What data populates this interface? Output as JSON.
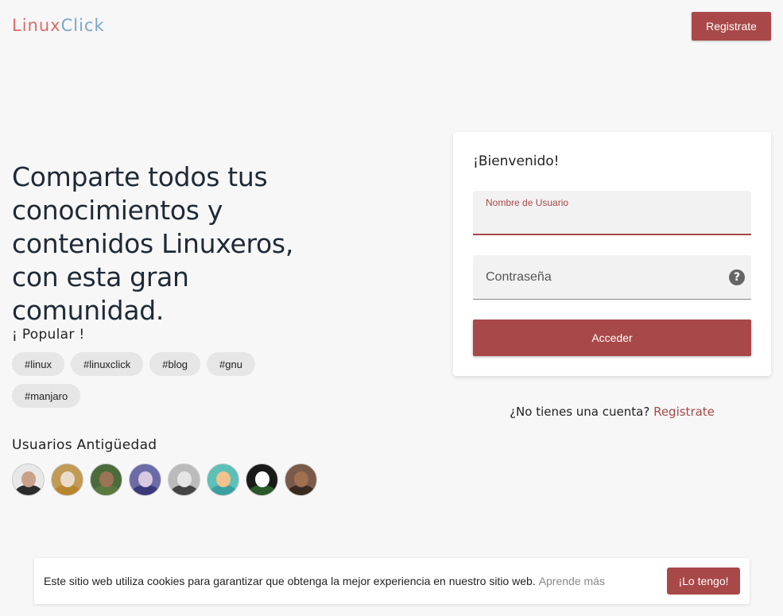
{
  "header": {
    "logo_part1": "Linux",
    "logo_part2": "Click",
    "register_label": "Registrate"
  },
  "hero": {
    "title": "Comparte todos tus conocimientos y contenidos Linuxeros, con esta gran comunidad."
  },
  "popular": {
    "label": "¡ Popular !",
    "tags": [
      "#linux",
      "#linuxclick",
      "#blog",
      "#gnu",
      "#manjaro"
    ]
  },
  "users": {
    "label": "Usuarios  Antigüedad",
    "avatars": [
      {
        "name": "avatar-1",
        "face": "#c9a089",
        "body": "#2a2a2a",
        "bg": "#e8e8e8"
      },
      {
        "name": "avatar-2",
        "face": "#e9dcc8",
        "body": "#b8862e",
        "bg": "#c19a55"
      },
      {
        "name": "avatar-3",
        "face": "#9b7355",
        "body": "#5a7a40",
        "bg": "#4b6b3a"
      },
      {
        "name": "avatar-4",
        "face": "#d8c8e0",
        "body": "#3a3a7a",
        "bg": "#6b6ba8"
      },
      {
        "name": "avatar-5",
        "face": "#e6e6e6",
        "body": "#444444",
        "bg": "#bbbbbb"
      },
      {
        "name": "avatar-6",
        "face": "#f2c28c",
        "body": "#3aa0a0",
        "bg": "#5cc0b8"
      },
      {
        "name": "avatar-7",
        "face": "#ffffff",
        "body": "#2a5a2a",
        "bg": "#1a1a1a"
      },
      {
        "name": "avatar-8",
        "face": "#a07050",
        "body": "#3a2a20",
        "bg": "#7a5a4a"
      }
    ]
  },
  "login": {
    "title": "¡Bienvenido!",
    "username_label": "Nombre de Usuario",
    "username_value": "",
    "password_label": "Contraseña",
    "help_icon": "help-icon",
    "submit_label": "Acceder"
  },
  "signup_prompt": {
    "text": "¿No tienes una cuenta?",
    "link": "Registrate"
  },
  "cookie": {
    "text": "Este sitio web utiliza cookies para garantizar que obtenga la mejor experiencia en nuestro sitio web.",
    "learn_more": "Aprende más",
    "accept_label": "¡Lo tengo!"
  },
  "colors": {
    "accent": "#a84848",
    "background": "#f7f7f7"
  }
}
